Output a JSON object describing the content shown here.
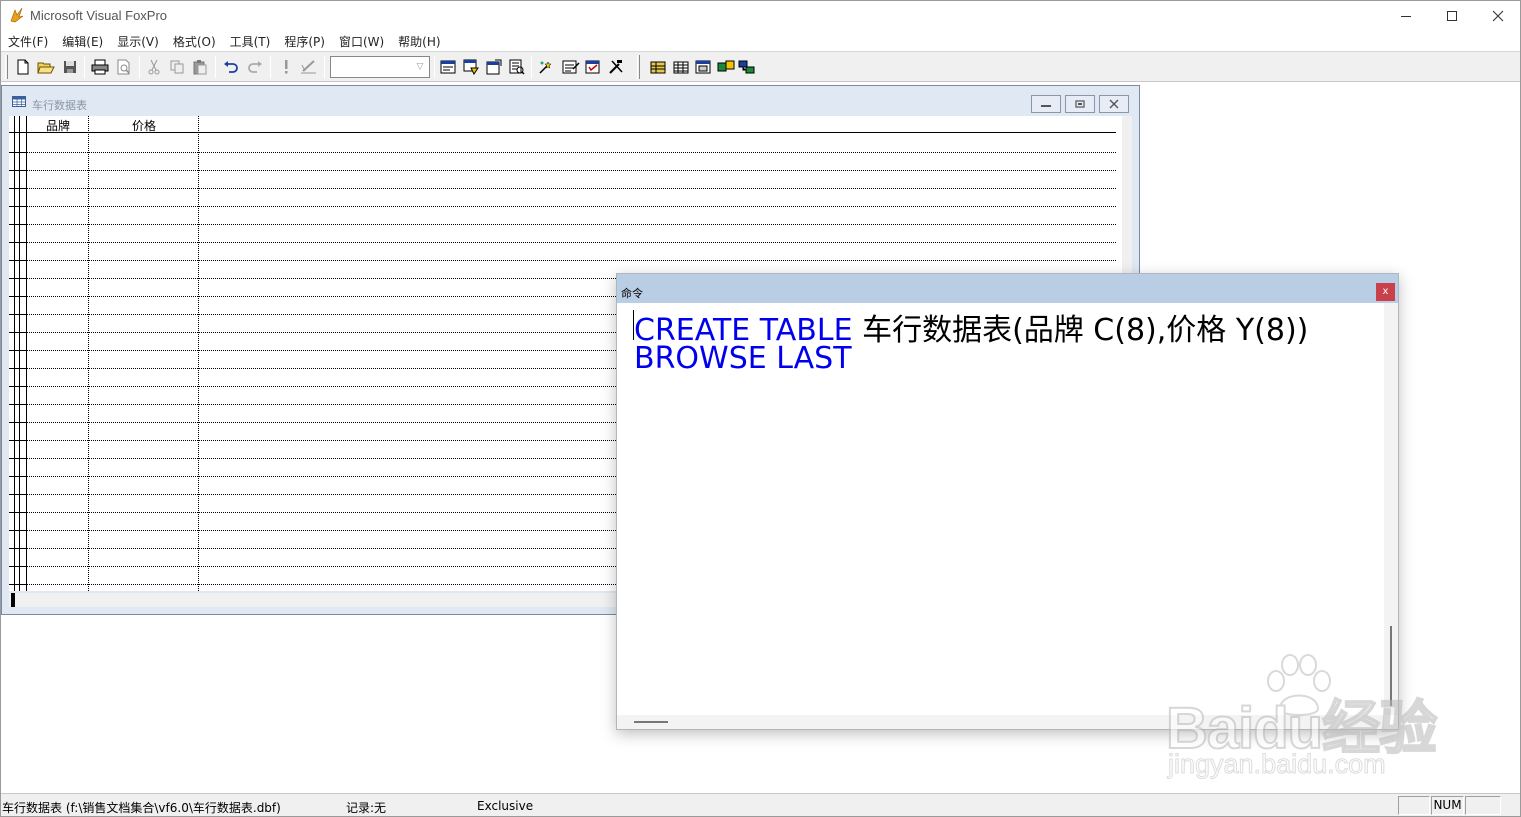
{
  "app": {
    "title": "Microsoft Visual FoxPro"
  },
  "menu": {
    "items": [
      "文件(F)",
      "编辑(E)",
      "显示(V)",
      "格式(O)",
      "工具(T)",
      "程序(P)",
      "窗口(W)",
      "帮助(H)"
    ]
  },
  "toolbar": {
    "combo_value": ""
  },
  "browse_window": {
    "title": "车行数据表",
    "columns": [
      "品牌",
      "价格"
    ]
  },
  "command_window": {
    "title": "命令",
    "close_label": "x",
    "line1_keyword": "CREATE TABLE",
    "line1_rest": " 车行数据表(品牌 C(8),价格 Y(8))",
    "line2_keyword": "BROWSE LAST"
  },
  "statusbar": {
    "table_info": "车行数据表 (f:\\销售文档集合\\vf6.0\\车行数据表.dbf)",
    "record": "记录:无",
    "mode": "Exclusive",
    "num": "NUM"
  },
  "watermark": {
    "brand": "Baidu经验",
    "sub": "jingyan.baidu.com"
  },
  "colors": {
    "keyword": "#0000ee",
    "command_titlebar": "#b9cde5",
    "browse_frame": "#dfe8f3",
    "close_red": "#c9404a"
  }
}
